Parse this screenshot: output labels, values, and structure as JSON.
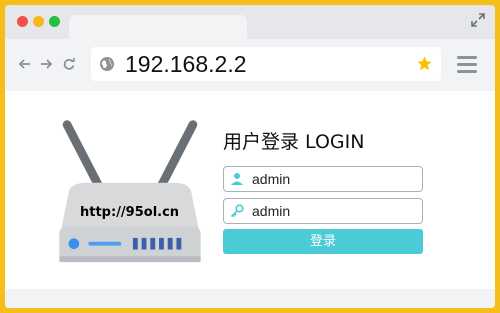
{
  "address_bar": {
    "url": "192.168.2.2"
  },
  "router": {
    "label": "http://95ol.cn"
  },
  "login": {
    "title": "用户登录 LOGIN",
    "username_value": "admin",
    "password_value": "admin",
    "button_label": "登录"
  },
  "icons": {
    "window_controls": [
      "close-dot",
      "minimize-dot",
      "maximize-dot"
    ],
    "nav": [
      "back-arrow-icon",
      "forward-arrow-icon",
      "reload-icon"
    ],
    "address": [
      "globe-icon",
      "star-icon"
    ],
    "toolbar": [
      "menu-icon",
      "expand-icon"
    ],
    "fields": [
      "user-icon",
      "key-icon"
    ]
  },
  "colors": {
    "frame": "#F5BF1A",
    "button": "#4BCBD6",
    "star": "#F8C100"
  }
}
